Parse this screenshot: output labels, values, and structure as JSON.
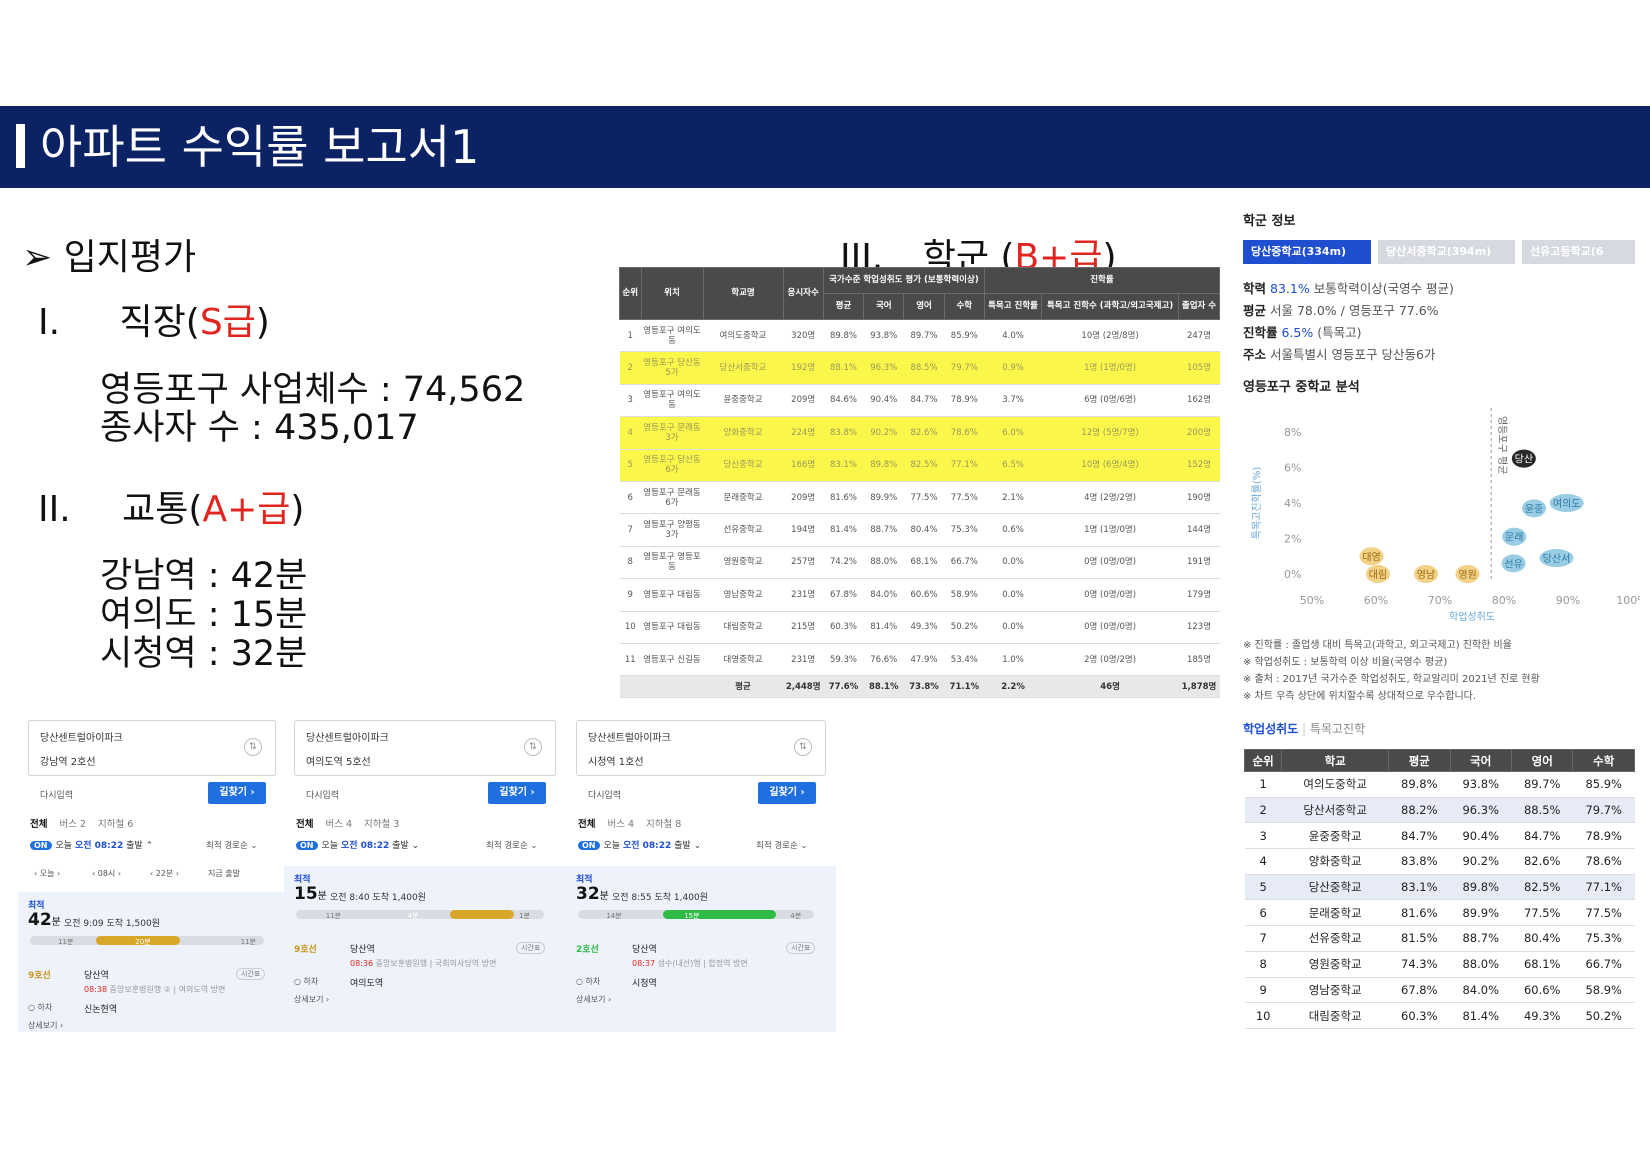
{
  "header": {
    "title": "아파트 수익률 보고서1"
  },
  "left": {
    "section": "➢  입지평가",
    "job": {
      "num": "I.",
      "label": "직장(",
      "grade": "S급",
      "end": ")"
    },
    "job_stats": [
      "영등포구 사업체수 : 74,562",
      "종사자 수 : 435,017"
    ],
    "traffic": {
      "num": "II.",
      "label": "교통(",
      "grade": "A+급",
      "end": ")"
    },
    "traffic_stats": [
      "강남역 : 42분",
      "여의도 : 15분",
      "시청역 : 32분"
    ]
  },
  "school": {
    "num": "III.",
    "label": "학군 (",
    "grade": "B+급",
    "end": ")"
  },
  "center_table": {
    "group_headers": [
      "국가수준 학업성취도 평가 (보통학력이상)",
      "진학률"
    ],
    "headers": [
      "순위",
      "위치",
      "학교명",
      "응시자수",
      "평균",
      "국어",
      "영어",
      "수학",
      "특목고 진학률",
      "특목고 진학수 (과학고/외고국제고)",
      "졸업자 수"
    ],
    "rows": [
      [
        "1",
        "영등포구 여의도 동",
        "여의도중학교",
        "320명",
        "89.8%",
        "93.8%",
        "89.7%",
        "85.9%",
        "4.0%",
        "10명 (2명/8명)",
        "247명"
      ],
      [
        "2",
        "영등포구 당산동 5가",
        "당산서중학교",
        "192명",
        "88.1%",
        "96.3%",
        "88.5%",
        "79.7%",
        "0.9%",
        "1명 (1명/0명)",
        "105명"
      ],
      [
        "3",
        "영등포구 여의도 동",
        "윤중중학교",
        "209명",
        "84.6%",
        "90.4%",
        "84.7%",
        "78.9%",
        "3.7%",
        "6명 (0명/6명)",
        "162명"
      ],
      [
        "4",
        "영등포구 문래동 3가",
        "양화중학교",
        "224명",
        "83.8%",
        "90.2%",
        "82.6%",
        "78.6%",
        "6.0%",
        "12명 (5명/7명)",
        "200명"
      ],
      [
        "5",
        "영등포구 당산동 6가",
        "당산중학교",
        "166명",
        "83.1%",
        "89.8%",
        "82.5%",
        "77.1%",
        "6.5%",
        "10명 (6명/4명)",
        "152명"
      ],
      [
        "6",
        "영등포구 문래동 6가",
        "문래중학교",
        "209명",
        "81.6%",
        "89.9%",
        "77.5%",
        "77.5%",
        "2.1%",
        "4명 (2명/2명)",
        "190명"
      ],
      [
        "7",
        "영등포구 양평동 3가",
        "선유중학교",
        "194명",
        "81.4%",
        "88.7%",
        "80.4%",
        "75.3%",
        "0.6%",
        "1명 (1명/0명)",
        "144명"
      ],
      [
        "8",
        "영등포구 영등포 동",
        "영원중학교",
        "257명",
        "74.2%",
        "88.0%",
        "68.1%",
        "66.7%",
        "0.0%",
        "0명 (0명/0명)",
        "191명"
      ],
      [
        "9",
        "영등포구 대림동",
        "영남중학교",
        "231명",
        "67.8%",
        "84.0%",
        "60.6%",
        "58.9%",
        "0.0%",
        "0명 (0명/0명)",
        "179명"
      ],
      [
        "10",
        "영등포구 대림동",
        "대림중학교",
        "215명",
        "60.3%",
        "81.4%",
        "49.3%",
        "50.2%",
        "0.0%",
        "0명 (0명/0명)",
        "123명"
      ],
      [
        "11",
        "영등포구 신길동",
        "대영중학교",
        "231명",
        "59.3%",
        "76.6%",
        "47.9%",
        "53.4%",
        "1.0%",
        "2명 (0명/2명)",
        "185명"
      ]
    ],
    "highlight_rows": [
      1,
      3,
      4
    ],
    "footer": [
      "",
      "",
      "평균",
      "2,448명",
      "77.6%",
      "88.1%",
      "73.8%",
      "71.1%",
      "2.2%",
      "46명",
      "1,878명"
    ]
  },
  "routes": [
    {
      "from": "당산센트럴아이파크",
      "to": "강남역 2호선",
      "reset": "다시입력",
      "go": "길찾기 ›",
      "tabs": [
        "전체",
        "버스 2",
        "지하철 6"
      ],
      "on": "ON",
      "dep_today": "오늘",
      "dep_time": "오전 08:22",
      "dep_suffix": "출발 ⌃",
      "sort": "최적 경로순 ⌄",
      "selectors": [
        "‹  오늘  ›",
        "‹  08시  ›",
        "‹  22분  ›",
        "지금 출발"
      ],
      "best": "최적",
      "mins": "42",
      "min_unit": "분",
      "arrive": "오전 9:09 도착   1,500원",
      "seg_labels": [
        "11분",
        "20분",
        "11분"
      ],
      "line": "9호선",
      "station": "당산역",
      "time_note": "08:38",
      "note": "중앙보훈병원행 ② | 여의도역 방면",
      "pill": "시간표",
      "alight": "○ 하차",
      "alight_stn": "신논현역",
      "more": "상세보기 ›"
    },
    {
      "from": "당산센트럴아이파크",
      "to": "여의도역 5호선",
      "reset": "다시입력",
      "go": "길찾기 ›",
      "tabs": [
        "전체",
        "버스 4",
        "지하철 3"
      ],
      "on": "ON",
      "dep_today": "오늘",
      "dep_time": "오전 08:22",
      "dep_suffix": "출발 ⌄",
      "sort": "최적 경로순 ⌄",
      "best": "최적",
      "mins": "15",
      "min_unit": "분",
      "arrive": "오전 8:40 도착   1,400원",
      "seg_labels": [
        "11분",
        "4분",
        "1분"
      ],
      "line": "9호선",
      "station": "당산역",
      "time_note": "08:36",
      "note": "중앙보훈병원행 | 국회의사당역 방면",
      "pill": "시간표",
      "alight": "○ 하차",
      "alight_stn": "여의도역",
      "more": "상세보기 ›"
    },
    {
      "from": "당산센트럴아이파크",
      "to": "시청역 1호선",
      "reset": "다시입력",
      "go": "길찾기 ›",
      "tabs": [
        "전체",
        "버스 4",
        "지하철 8"
      ],
      "on": "ON",
      "dep_today": "오늘",
      "dep_time": "오전 08:22",
      "dep_suffix": "출발 ⌄",
      "sort": "최적 경로순 ⌄",
      "best": "최적",
      "mins": "32",
      "min_unit": "분",
      "arrive": "오전 8:55 도착   1,400원",
      "seg_labels": [
        "14분",
        "15분",
        "4분"
      ],
      "line": "2호선",
      "station": "당산역",
      "time_note": "08:37",
      "note": "성수(내선)행 | 합정역 방면",
      "pill": "시간표",
      "alight": "○ 하차",
      "alight_stn": "시청역",
      "more": "상세보기 ›"
    }
  ],
  "right": {
    "title": "학군 정보",
    "tabs": [
      "당산중학교(334m)",
      "당산서중학교(394m)",
      "선유고등학교(6"
    ],
    "info": [
      {
        "k": "학력",
        "v": "83.1%",
        "r": "보통학력이상(국영수 평균)"
      },
      {
        "k": "평균",
        "v": "",
        "r": "서울 78.0% / 영등포구 77.6%"
      },
      {
        "k": "진학률",
        "v": "6.5%",
        "r": "(특목고)"
      },
      {
        "k": "주소",
        "v": "",
        "r": "서울특별시 영등포구 당산동6가"
      }
    ],
    "analysis_title": "영등포구 중학교 분석",
    "notes": [
      "※ 진학률 : 졸업생 대비 특목고(과학고, 외고국제고) 진학한 비율",
      "※ 학업성취도 : 보통학력 이상 비율(국영수 평균)",
      "※ 출처 : 2017년 국가수준 학업성취도, 학교알리미 2021년 진로 현황",
      "※ 차트 우측 상단에 위치할수록 상대적으로 우수합니다."
    ],
    "subtabs": [
      "학업성취도",
      "특목고진학"
    ],
    "table_headers": [
      "순위",
      "학교",
      "평균",
      "국어",
      "영어",
      "수학"
    ],
    "table_rows": [
      [
        "1",
        "여의도중학교",
        "89.8%",
        "93.8%",
        "89.7%",
        "85.9%"
      ],
      [
        "2",
        "당산서중학교",
        "88.2%",
        "96.3%",
        "88.5%",
        "79.7%"
      ],
      [
        "3",
        "윤중중학교",
        "84.7%",
        "90.4%",
        "84.7%",
        "78.9%"
      ],
      [
        "4",
        "양화중학교",
        "83.8%",
        "90.2%",
        "82.6%",
        "78.6%"
      ],
      [
        "5",
        "당산중학교",
        "83.1%",
        "89.8%",
        "82.5%",
        "77.1%"
      ],
      [
        "6",
        "문래중학교",
        "81.6%",
        "89.9%",
        "77.5%",
        "77.5%"
      ],
      [
        "7",
        "선유중학교",
        "81.5%",
        "88.7%",
        "80.4%",
        "75.3%"
      ],
      [
        "8",
        "영원중학교",
        "74.3%",
        "88.0%",
        "68.1%",
        "66.7%"
      ],
      [
        "9",
        "영남중학교",
        "67.8%",
        "84.0%",
        "60.6%",
        "58.9%"
      ],
      [
        "10",
        "대림중학교",
        "60.3%",
        "81.4%",
        "49.3%",
        "50.2%"
      ]
    ],
    "selected_rows": [
      1,
      4
    ]
  },
  "chart_data": {
    "type": "scatter",
    "title": "",
    "xlabel": "학업성취도",
    "ylabel": "특목고진학률(%)",
    "xlim": [
      50,
      100
    ],
    "ylim": [
      0,
      8
    ],
    "xticks": [
      "50%",
      "60%",
      "70%",
      "80%",
      "90%",
      "100%"
    ],
    "yticks": [
      "0%",
      "2%",
      "4%",
      "6%",
      "8%"
    ],
    "ref_line": {
      "x": 78,
      "label": "영등포구 평균"
    },
    "points": [
      {
        "name": "당산",
        "x": 83.1,
        "y": 6.5,
        "color": "#111111"
      },
      {
        "name": "윤중",
        "x": 84.7,
        "y": 3.7,
        "color": "#8fc6e0"
      },
      {
        "name": "여의도",
        "x": 89.8,
        "y": 4.0,
        "color": "#8fc6e0"
      },
      {
        "name": "문래",
        "x": 81.6,
        "y": 2.1,
        "color": "#8fc6e0"
      },
      {
        "name": "선유",
        "x": 81.5,
        "y": 0.6,
        "color": "#8fc6e0"
      },
      {
        "name": "당산서",
        "x": 88.2,
        "y": 0.9,
        "color": "#8fc6e0"
      },
      {
        "name": "대영",
        "x": 59.3,
        "y": 1.0,
        "color": "#f2cd7a"
      },
      {
        "name": "대림",
        "x": 60.3,
        "y": 0.0,
        "color": "#f2cd7a"
      },
      {
        "name": "영남",
        "x": 67.8,
        "y": 0.0,
        "color": "#f2cd7a"
      },
      {
        "name": "영원",
        "x": 74.3,
        "y": 0.0,
        "color": "#f2cd7a"
      }
    ]
  }
}
